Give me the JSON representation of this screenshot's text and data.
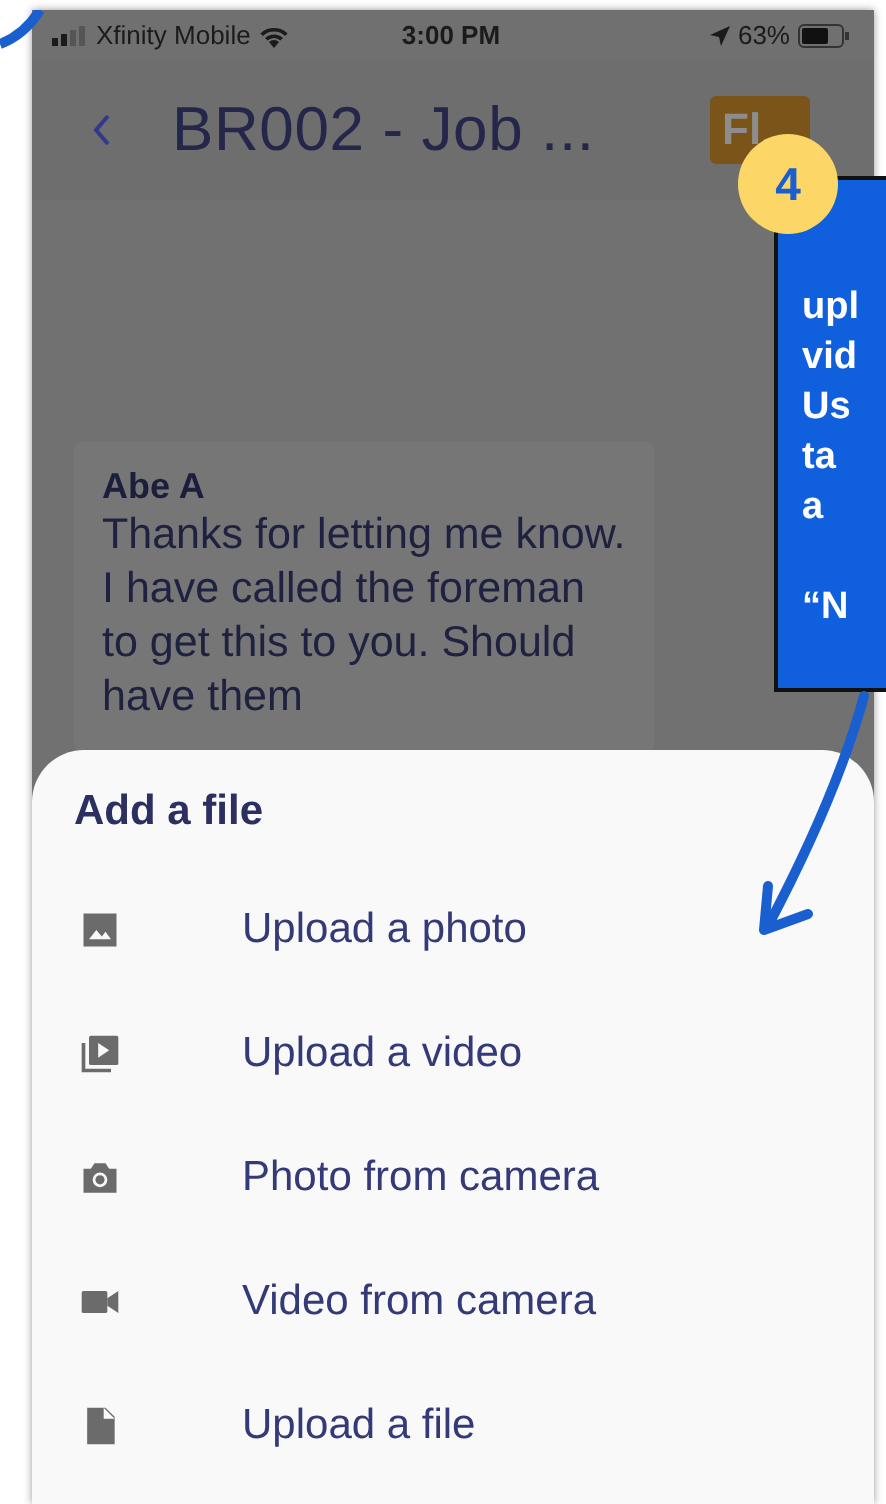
{
  "status_bar": {
    "carrier": "Xfinity Mobile",
    "time": "3:00 PM",
    "battery": "63%"
  },
  "header": {
    "title": "BR002 - Job ...",
    "flag_button": "Fl"
  },
  "messages": [
    {
      "author": "Abe A",
      "text": "Thanks for letting me know. I have called the foreman to get this to you. Should have them"
    }
  ],
  "sheet": {
    "title": "Add a file",
    "options": [
      {
        "kind": "image",
        "label": "Upload a photo"
      },
      {
        "kind": "video",
        "label": "Upload a video"
      },
      {
        "kind": "camera",
        "label": "Photo from camera"
      },
      {
        "kind": "videocam",
        "label": "Video from camera"
      },
      {
        "kind": "file",
        "label": "Upload a file"
      }
    ]
  },
  "callout": {
    "step": "4",
    "paragraphs": [
      [
        "upl",
        "vid",
        "Us",
        "ta",
        "a"
      ],
      [
        "“N"
      ]
    ]
  }
}
